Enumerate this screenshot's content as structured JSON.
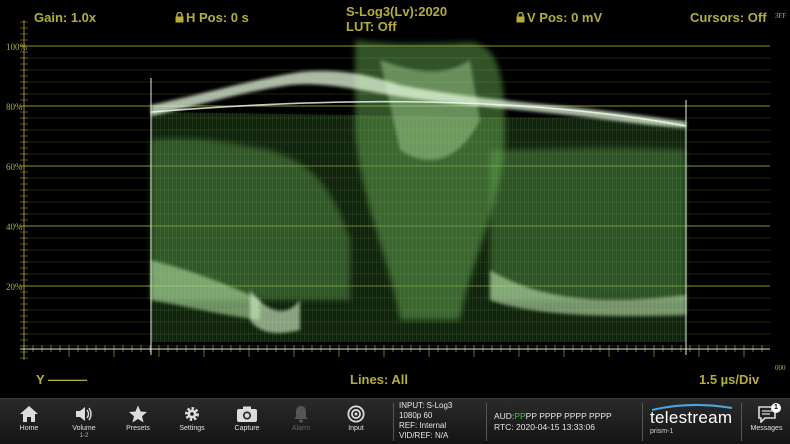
{
  "overlay": {
    "gain": "Gain: 1.0x",
    "h_pos": "H Pos: 0 s",
    "colorspace": "S-Log3(Lv):2020",
    "lut": "LUT: Off",
    "v_pos": "V Pos: 0 mV",
    "cursors": "Cursors: Off",
    "top_right_value": "3FF",
    "channel": "Y ———",
    "lines": "Lines: All",
    "time_div": "1.5 µs/Div",
    "bottom_right_value": "000"
  },
  "graticule": [
    "100%",
    "80%",
    "60%",
    "40%",
    "20%"
  ],
  "colors": {
    "trace": "#7ec86a",
    "graticule": "#b4ad3c",
    "toolbar": "#1e1e1e"
  },
  "toolbar": {
    "buttons": [
      {
        "label": "Home",
        "icon": "home-icon"
      },
      {
        "label": "Volume",
        "sub": "1-2",
        "icon": "speaker-icon"
      },
      {
        "label": "Presets",
        "icon": "star-icon"
      },
      {
        "label": "Settings",
        "icon": "gear-icon"
      },
      {
        "label": "Capture",
        "icon": "camera-icon"
      },
      {
        "label": "Alarm",
        "icon": "bell-icon"
      },
      {
        "label": "Input",
        "icon": "input-icon"
      }
    ],
    "input": {
      "input_label": "INPUT:",
      "input_value": "S-Log3",
      "format": "1080p 60",
      "ref": "REF: Internal",
      "vid_ref": "VID/REF: N/A"
    },
    "audio": {
      "label": "AUD:",
      "group1_active": "PP",
      "group1_rest": "PP PPPP PPPP PPPP",
      "rtc": "RTC: 2020-04-15 13:33:06"
    },
    "brand": {
      "name": "telestream",
      "model": "prism-1"
    },
    "messages": {
      "label": "Messages",
      "count": "1"
    }
  }
}
